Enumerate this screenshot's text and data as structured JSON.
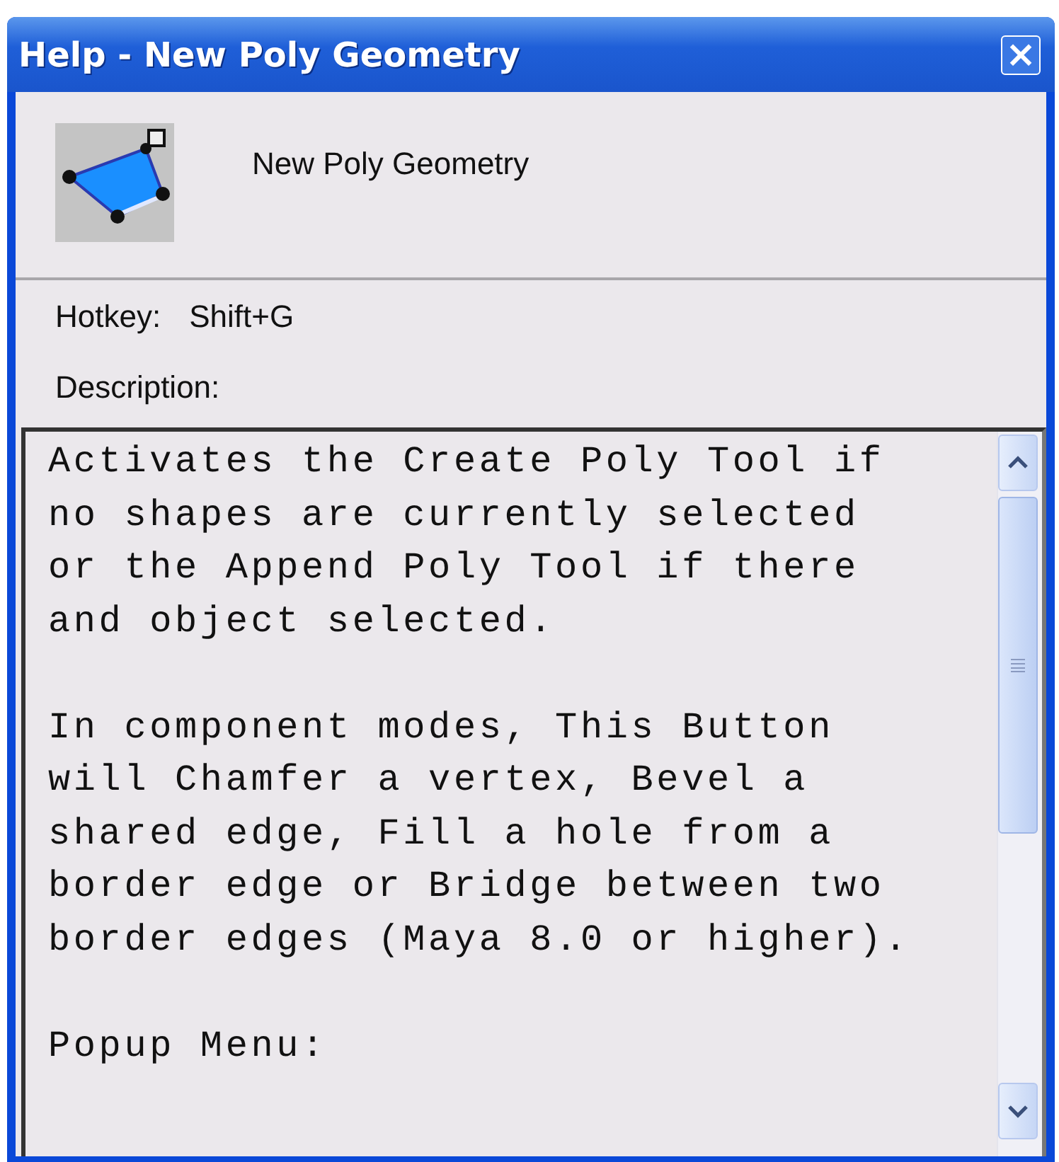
{
  "window": {
    "title": "Help - New Poly Geometry",
    "close": "×"
  },
  "header": {
    "tool_name": "New Poly Geometry"
  },
  "hotkey": {
    "label": "Hotkey:",
    "value": "Shift+G"
  },
  "description": {
    "label": "Description:",
    "text": "Activates the Create Poly Tool if\nno shapes are currently selected\nor the Append Poly Tool if there\nand object selected.\n\nIn component modes, This Button\nwill Chamfer a vertex, Bevel a\nshared edge, Fill a hole from a\nborder edge or Bridge between two\nborder edges (Maya 8.0 or higher).\n\nPopup Menu:"
  }
}
